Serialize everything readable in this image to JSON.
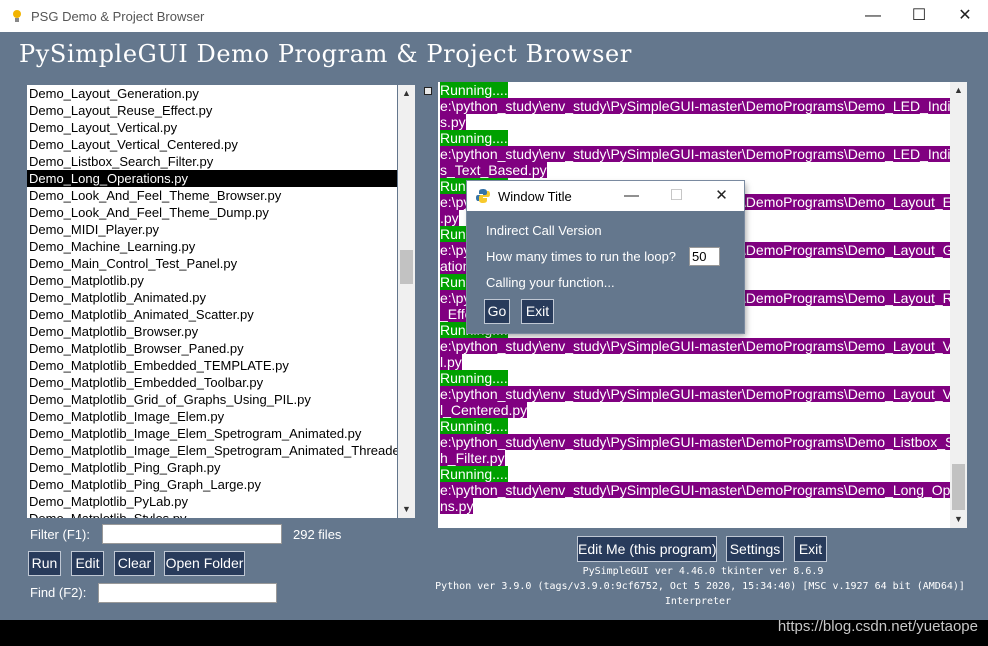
{
  "window": {
    "title": "PSG Demo & Project Browser",
    "controls": {
      "minimize": "—",
      "maximize": "☐",
      "close": "✕"
    }
  },
  "header": {
    "title": "PySimpleGUI Demo Program & Project Browser"
  },
  "file_list": {
    "items": [
      "Demo_Layout_Generation.py",
      "Demo_Layout_Reuse_Effect.py",
      "Demo_Layout_Vertical.py",
      "Demo_Layout_Vertical_Centered.py",
      "Demo_Listbox_Search_Filter.py",
      "Demo_Long_Operations.py",
      "Demo_Look_And_Feel_Theme_Browser.py",
      "Demo_Look_And_Feel_Theme_Dump.py",
      "Demo_MIDI_Player.py",
      "Demo_Machine_Learning.py",
      "Demo_Main_Control_Test_Panel.py",
      "Demo_Matplotlib.py",
      "Demo_Matplotlib_Animated.py",
      "Demo_Matplotlib_Animated_Scatter.py",
      "Demo_Matplotlib_Browser.py",
      "Demo_Matplotlib_Browser_Paned.py",
      "Demo_Matplotlib_Embedded_TEMPLATE.py",
      "Demo_Matplotlib_Embedded_Toolbar.py",
      "Demo_Matplotlib_Grid_of_Graphs_Using_PIL.py",
      "Demo_Matplotlib_Image_Elem.py",
      "Demo_Matplotlib_Image_Elem_Spetrogram_Animated.py",
      "Demo_Matplotlib_Image_Elem_Spetrogram_Animated_Threaded.py",
      "Demo_Matplotlib_Ping_Graph.py",
      "Demo_Matplotlib_Ping_Graph_Large.py",
      "Demo_Matplotlib_PyLab.py",
      "Demo_Matplotlib_Styles.py"
    ],
    "selected_index": 5
  },
  "filter": {
    "label": "Filter (F1):",
    "value": "",
    "count_text": "292 files"
  },
  "find": {
    "label": "Find (F2):",
    "value": ""
  },
  "left_buttons": {
    "run": "Run",
    "edit": "Edit",
    "clear": "Clear",
    "open_folder": "Open Folder"
  },
  "output": {
    "lines": [
      {
        "text": "Running....",
        "kind": "running"
      },
      {
        "text": "e:\\python_study\\env_study\\PySimpleGUI-master\\DemoPrograms\\Demo_LED_Indicator",
        "kind": "path"
      },
      {
        "text": "s.py",
        "kind": "path"
      },
      {
        "text": "Running....",
        "kind": "running"
      },
      {
        "text": "e:\\python_study\\env_study\\PySimpleGUI-master\\DemoPrograms\\Demo_LED_Indicator",
        "kind": "path"
      },
      {
        "text": "s_Text_Based.py",
        "kind": "path"
      },
      {
        "text": "Running....",
        "kind": "running"
      },
      {
        "text": "e:\\python_study\\env_study\\PySimpleGUI-master\\DemoPrograms\\Demo_Layout_Extend",
        "kind": "path"
      },
      {
        "text": ".py",
        "kind": "path"
      },
      {
        "text": "Running....",
        "kind": "running"
      },
      {
        "text": "e:\\python_study\\env_study\\PySimpleGUI-master\\DemoPrograms\\Demo_Layout_Gener",
        "kind": "path"
      },
      {
        "text": "ation.py",
        "kind": "path"
      },
      {
        "text": "Running....",
        "kind": "running"
      },
      {
        "text": "e:\\python_study\\env_study\\PySimpleGUI-master\\DemoPrograms\\Demo_Layout_Reuse",
        "kind": "path"
      },
      {
        "text": "_Effect.py",
        "kind": "path"
      },
      {
        "text": "Running....",
        "kind": "running"
      },
      {
        "text": "e:\\python_study\\env_study\\PySimpleGUI-master\\DemoPrograms\\Demo_Layout_Vertica",
        "kind": "path"
      },
      {
        "text": "l.py",
        "kind": "path"
      },
      {
        "text": "Running....",
        "kind": "running"
      },
      {
        "text": "e:\\python_study\\env_study\\PySimpleGUI-master\\DemoPrograms\\Demo_Layout_Vertica",
        "kind": "path"
      },
      {
        "text": "l_Centered.py",
        "kind": "path"
      },
      {
        "text": "Running....",
        "kind": "running"
      },
      {
        "text": "e:\\python_study\\env_study\\PySimpleGUI-master\\DemoPrograms\\Demo_Listbox_Searc",
        "kind": "path"
      },
      {
        "text": "h_Filter.py",
        "kind": "path"
      },
      {
        "text": "Running....",
        "kind": "running"
      },
      {
        "text": "e:\\python_study\\env_study\\PySimpleGUI-master\\DemoPrograms\\Demo_Long_Operatio",
        "kind": "path"
      },
      {
        "text": "ns.py",
        "kind": "path"
      }
    ]
  },
  "right_buttons": {
    "edit_me": "Edit Me (this program)",
    "settings": "Settings",
    "exit": "Exit"
  },
  "version_info": {
    "psg": "PySimpleGUI ver 4.46.0   tkinter ver 8.6.9",
    "python": "Python ver 3.9.0 (tags/v3.9.0:9cf6752, Oct  5 2020, 15:34:40) [MSC v.1927 64 bit (AMD64)]",
    "interpreter": "Interpreter"
  },
  "popup": {
    "title": "Window Title",
    "heading": "Indirect Call Version",
    "question": "How many times to run the loop?",
    "loop_value": "50",
    "status": "Calling your function...",
    "go": "Go",
    "exit": "Exit"
  },
  "watermark": "https://blog.csdn.net/yuetaope",
  "colors": {
    "background": "#64778d",
    "button": "#283b5b",
    "running_highlight": "#00a000",
    "path_highlight": "#800080",
    "selected_row": "#000000"
  }
}
